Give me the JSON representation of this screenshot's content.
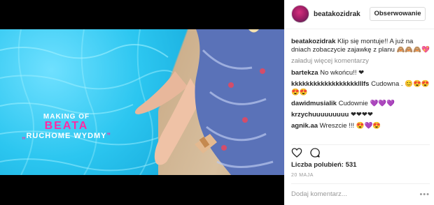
{
  "media": {
    "title_line1": "MAKING OF",
    "title_line2": "BEATA",
    "title_line3": "RUCHOME WYDMY",
    "open_quote": "„",
    "close_quote": "”"
  },
  "header": {
    "username": "beatakozidrak",
    "follow_label": "Obserwowanie"
  },
  "caption": {
    "user": "beatakozidrak",
    "text": "Klip się montuje!! A już na dniach zobaczycie zajawkę z planu 🙈🙈🙈💖"
  },
  "load_more": "załaduj więcej komentarzy",
  "comments": [
    {
      "user": "bartekza",
      "text": "No wkońcu!! ❤"
    },
    {
      "user": "kkkkkkkkkkkkkkkkkklllfs",
      "text": "Cudowna . 😊😍😍😍😍"
    },
    {
      "user": "dawidmusialik",
      "text": "Cudownie 💜💜💜"
    },
    {
      "user": "krzychuuuuuuuuu",
      "text": "❤❤❤❤"
    },
    {
      "user": "agnik.aa",
      "text": "Wreszcie !!! 😍💜😍"
    }
  ],
  "likes_text": "Liczba polubień: 531",
  "date": "20 MAJA",
  "add_comment_placeholder": "Dodaj komentarz...",
  "more_dots": "•••",
  "icons": {
    "like": "heart-icon",
    "comment": "comment-icon"
  }
}
